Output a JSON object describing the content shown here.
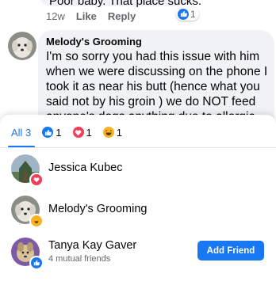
{
  "thread": {
    "prev_comment_text": "Poor baby. That place sucks.",
    "prev_comment_time": "12w",
    "like_label": "Like",
    "reply_label": "Reply",
    "prev_reaction_count": "1",
    "commenter_name": "Melody's Grooming",
    "comment_text": "I'm so sorry you had this issue with him when we were discussing on the phone I took it as near his butt (hence what you said not by his groin ) we do NOT feed anyone's dogs anything due to allergic reactions etc."
  },
  "reactions_sheet": {
    "tabs": [
      {
        "label": "All 3",
        "icon": null
      },
      {
        "label": "1",
        "icon": "like-icon"
      },
      {
        "label": "1",
        "icon": "love-icon"
      },
      {
        "label": "1",
        "icon": "haha-icon"
      }
    ],
    "people": [
      {
        "name": "Jessica Kubec",
        "reaction": "love-icon",
        "subtitle": ""
      },
      {
        "name": "Melody's Grooming",
        "reaction": "haha-icon",
        "subtitle": ""
      },
      {
        "name": "Tanya Kay Gaver",
        "reaction": "like-icon",
        "subtitle": "4 mutual friends",
        "action": "Add Friend"
      }
    ]
  },
  "colors": {
    "accent": "#1877f2",
    "like": "#1877f2",
    "love": "#f33e58",
    "haha": "#f7b125"
  }
}
